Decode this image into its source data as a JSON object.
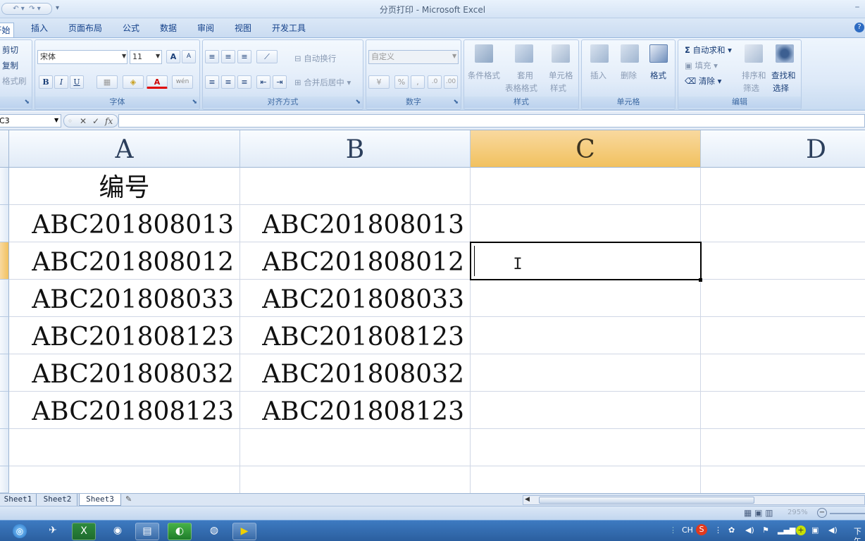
{
  "window": {
    "title": "分页打印 - Microsoft Excel"
  },
  "tabs": [
    "开始",
    "插入",
    "页面布局",
    "公式",
    "数据",
    "审阅",
    "视图",
    "开发工具"
  ],
  "clipboard": {
    "cut": "剪切",
    "copy": "复制",
    "painter": "格式刷"
  },
  "font": {
    "name": "宋体",
    "size": "11",
    "group_label": "字体",
    "bold": "B",
    "italic": "I",
    "underline": "U",
    "grow": "A",
    "shrink": "A",
    "font_color": "A",
    "phonetic": "wén"
  },
  "alignment": {
    "wrap": "自动换行",
    "merge": "合并后居中",
    "group_label": "对齐方式"
  },
  "number": {
    "format": "自定义",
    "group_label": "数字",
    "percent": "%",
    "comma": ","
  },
  "styles": {
    "conditional": "条件格式",
    "table_1": "套用",
    "table_2": "表格格式",
    "cell_1": "单元格",
    "cell_2": "样式",
    "group_label": "样式"
  },
  "cells": {
    "insert": "插入",
    "delete": "删除",
    "format": "格式",
    "group_label": "单元格"
  },
  "editing": {
    "autosum": "自动求和",
    "sigma": "Σ",
    "fill": "填充",
    "clear": "清除",
    "sort_1": "排序和",
    "sort_2": "筛选",
    "find_1": "查找和",
    "find_2": "选择",
    "group_label": "编辑"
  },
  "formula_bar": {
    "name_box": "C3",
    "fx": "fx",
    "value": ""
  },
  "columns": [
    "A",
    "B",
    "C",
    "D"
  ],
  "rows": [
    {
      "a": "编号",
      "b": ""
    },
    {
      "a": "ABC201808013",
      "b": "ABC201808013"
    },
    {
      "a": "ABC201808012",
      "b": "ABC201808012"
    },
    {
      "a": "ABC201808033",
      "b": "ABC201808033"
    },
    {
      "a": "ABC201808123",
      "b": "ABC201808123"
    },
    {
      "a": "ABC201808032",
      "b": "ABC201808032"
    },
    {
      "a": "ABC201808123",
      "b": "ABC201808123"
    }
  ],
  "sheets": [
    "Sheet1",
    "Sheet2",
    "Sheet3"
  ],
  "status": {
    "zoom": "295%"
  },
  "tray": {
    "lang": "CH",
    "time": "下午"
  },
  "colors": {
    "selected_header": "#f1c15f",
    "ribbon": "#dde9f8",
    "taskbar": "#2b5f9f"
  }
}
